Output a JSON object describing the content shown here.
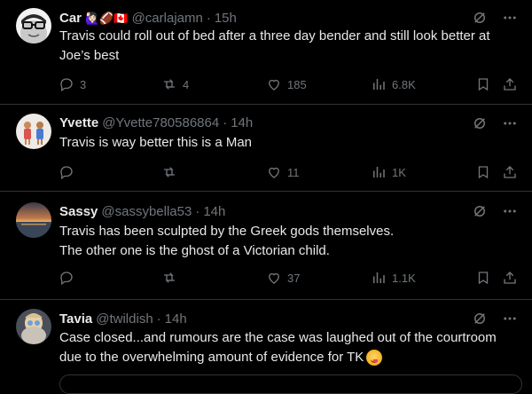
{
  "posts": [
    {
      "name": "Car",
      "name_emojis": "🙋🏻‍♀️🏈🇨🇦",
      "handle": "@carlajamn",
      "time": "15h",
      "lines": [
        "Travis could roll out of bed after a three day bender and still look better at",
        "Joe’s best"
      ],
      "replies": "3",
      "reposts": "4",
      "likes": "185",
      "views": "6.8K"
    },
    {
      "name": "Yvette",
      "handle": "@Yvette780586864",
      "time": "14h",
      "lines": [
        "Travis is way better this is a Man"
      ],
      "replies": "",
      "reposts": "",
      "likes": "11",
      "views": "1K"
    },
    {
      "name": "Sassy",
      "handle": "@sassybella53",
      "time": "14h",
      "lines": [
        "Travis has been sculpted by the Greek gods themselves.",
        "The other one is the ghost of a Victorian child."
      ],
      "replies": "",
      "reposts": "",
      "likes": "37",
      "views": "1.1K"
    },
    {
      "name": "Tavia",
      "handle": "@twildish",
      "time": "14h",
      "lines": [
        "Case closed...and rumours are the case was laughed out of the courtroom",
        "due to the overwhelming amount of evidence for TK"
      ],
      "replies": "",
      "reposts": "",
      "likes": "",
      "views": ""
    }
  ],
  "colors": {
    "background": "#000000",
    "text": "#e7e9ea",
    "muted": "#71767b",
    "divider": "#2f3336"
  },
  "icons": [
    "grok-icon",
    "more-icon",
    "reply-icon",
    "repost-icon",
    "like-icon",
    "views-icon",
    "bookmark-icon",
    "share-icon",
    "smiley-icon"
  ]
}
